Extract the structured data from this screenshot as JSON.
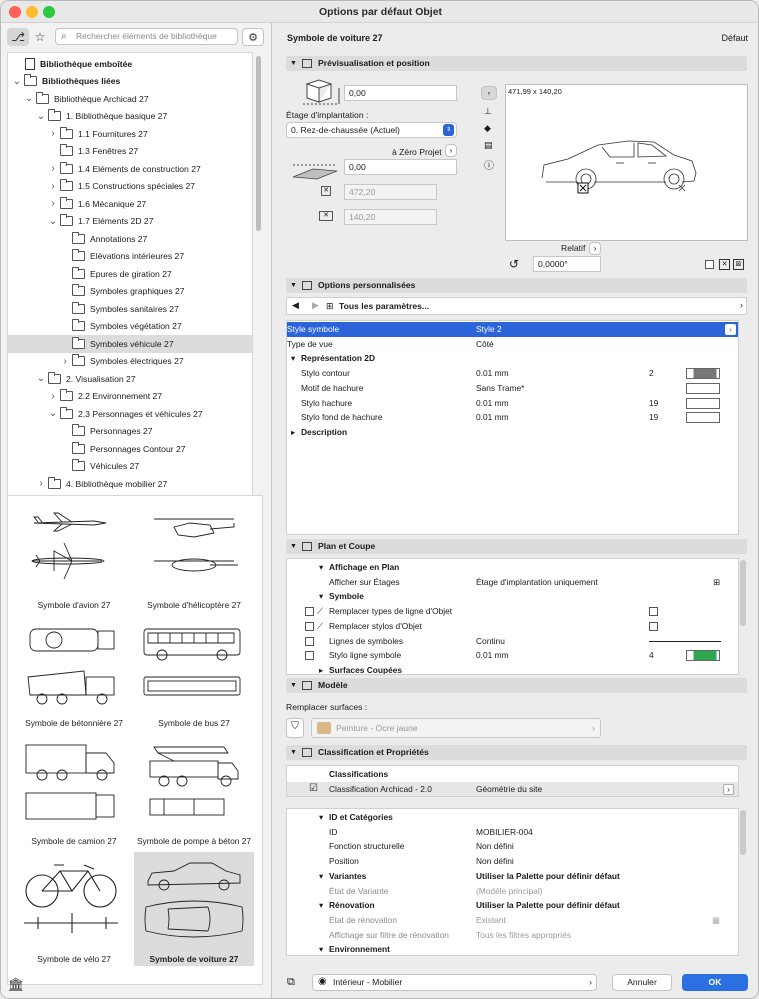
{
  "window": {
    "title": "Options par défaut Objet"
  },
  "library": {
    "search_placeholder": "Rechercher éléments de bibliothèque",
    "tree": [
      {
        "label": "Bibliothèque emboîtée",
        "level": 0,
        "arrow": "",
        "icon": "doc",
        "bold": true
      },
      {
        "label": "Bibliothèques liées",
        "level": 0,
        "arrow": "v",
        "icon": "stack",
        "bold": true
      },
      {
        "label": "Bibliothèque Archicad 27",
        "level": 1,
        "arrow": "v",
        "icon": "folder"
      },
      {
        "label": "1. Bibliothèque basique 27",
        "level": 2,
        "arrow": "v",
        "icon": "folder"
      },
      {
        "label": "1.1 Fournitures 27",
        "level": 3,
        "arrow": ">",
        "icon": "folder"
      },
      {
        "label": "1.3 Fenêtres 27",
        "level": 3,
        "arrow": "",
        "icon": "folder"
      },
      {
        "label": "1.4 Eléments de construction 27",
        "level": 3,
        "arrow": ">",
        "icon": "folder"
      },
      {
        "label": "1.5 Constructions spéciales 27",
        "level": 3,
        "arrow": ">",
        "icon": "folder"
      },
      {
        "label": "1.6 Mécanique 27",
        "level": 3,
        "arrow": ">",
        "icon": "folder"
      },
      {
        "label": "1.7 Eléments 2D 27",
        "level": 3,
        "arrow": "v",
        "icon": "folder"
      },
      {
        "label": "Annotations 27",
        "level": 4,
        "arrow": "",
        "icon": "folder"
      },
      {
        "label": "Elévations intérieures 27",
        "level": 4,
        "arrow": "",
        "icon": "folder"
      },
      {
        "label": "Epures de giration 27",
        "level": 4,
        "arrow": "",
        "icon": "folder"
      },
      {
        "label": "Symboles graphiques 27",
        "level": 4,
        "arrow": "",
        "icon": "folder"
      },
      {
        "label": "Symboles sanitaires 27",
        "level": 4,
        "arrow": "",
        "icon": "folder"
      },
      {
        "label": "Symboles végétation 27",
        "level": 4,
        "arrow": "",
        "icon": "folder"
      },
      {
        "label": "Symboles véhicule 27",
        "level": 4,
        "arrow": "",
        "icon": "folder",
        "selected": true
      },
      {
        "label": "Symboles électriques 27",
        "level": 4,
        "arrow": ">",
        "icon": "folder"
      },
      {
        "label": "2. Visualisation 27",
        "level": 2,
        "arrow": "v",
        "icon": "folder"
      },
      {
        "label": "2.2 Environnement 27",
        "level": 3,
        "arrow": ">",
        "icon": "folder"
      },
      {
        "label": "2.3 Personnages et véhicules 27",
        "level": 3,
        "arrow": "v",
        "icon": "folder"
      },
      {
        "label": "Personnages 27",
        "level": 4,
        "arrow": "",
        "icon": "folder"
      },
      {
        "label": "Personnages Contour 27",
        "level": 4,
        "arrow": "",
        "icon": "folder"
      },
      {
        "label": "Véhicules 27",
        "level": 4,
        "arrow": "",
        "icon": "folder"
      },
      {
        "label": "4. Bibliothèque mobilier 27",
        "level": 2,
        "arrow": ">",
        "icon": "folder"
      }
    ],
    "gallery": [
      {
        "label": "Symbole d'avion 27",
        "icon": "airplane-icon"
      },
      {
        "label": "Symbole d'hélicoptère 27",
        "icon": "helicopter-icon"
      },
      {
        "label": "Symbole de bétonnière 27",
        "icon": "concrete-mixer-icon"
      },
      {
        "label": "Symbole de bus 27",
        "icon": "bus-icon"
      },
      {
        "label": "Symbole de camion 27",
        "icon": "truck-icon"
      },
      {
        "label": "Symbole de pompe à béton 27",
        "icon": "concrete-pump-icon"
      },
      {
        "label": "Symbole de vélo 27",
        "icon": "bicycle-icon"
      },
      {
        "label": "Symbole de voiture 27",
        "icon": "car-icon",
        "selected": true
      }
    ]
  },
  "panel": {
    "object_name": "Symbole de voiture 27",
    "default_label": "Défaut",
    "preview_section": {
      "title": "Prévisualisation et position",
      "elevation_value": "0,00",
      "floor_label": "Étage d'implantation :",
      "floor_value": "0. Rez-de-chaussée (Actuel)",
      "zero_label": "à Zéro Projet",
      "zero_value": "0,00",
      "width_value": "472,20",
      "depth_value": "140,20",
      "preview_size": "471,99 x 140,20",
      "relative_label": "Relatif",
      "angle_value": "0,0000°"
    },
    "custom_section": {
      "title": "Options personnalisées",
      "nav_label": "Tous les paramètres...",
      "rows": [
        {
          "name": "Style symbole",
          "value": "Style 2",
          "selected": true,
          "indent": 0
        },
        {
          "name": "Type de vue",
          "value": "Côté",
          "indent": 0
        },
        {
          "name": "Représentation 2D",
          "value": "",
          "group": true,
          "arrow": "v"
        },
        {
          "name": "Stylo contour",
          "value": "0.01 mm",
          "num": "2",
          "swatch": "stripe-gray",
          "indent": 1
        },
        {
          "name": "Motif de hachure",
          "value": "Sans Trame*",
          "swatch": "empty",
          "indent": 1
        },
        {
          "name": "Stylo hachure",
          "value": "0.01 mm",
          "num": "19",
          "swatch": "empty",
          "indent": 1
        },
        {
          "name": "Stylo fond de hachure",
          "value": "0.01 mm",
          "num": "19",
          "swatch": "empty",
          "indent": 1
        },
        {
          "name": "Description",
          "value": "",
          "group": true,
          "arrow": ">"
        }
      ]
    },
    "plan_section": {
      "title": "Plan et Coupe",
      "rows": [
        {
          "name": "Affichage en Plan",
          "group": true,
          "arrow": "v"
        },
        {
          "name": "Afficher sur Étages",
          "value": "Étage d'implantation uniquement",
          "indent": 2
        },
        {
          "name": "Symbole",
          "group": true,
          "arrow": "v"
        },
        {
          "name": "Remplacer types de ligne d'Objet",
          "value": "",
          "check": true,
          "indent": 2
        },
        {
          "name": "Remplacer stylos d'Objet",
          "value": "",
          "check": true,
          "indent": 2
        },
        {
          "name": "Lignes de symboles",
          "value": "Continu",
          "line": true,
          "indent": 2
        },
        {
          "name": "Stylo ligne symbole",
          "value": "0.01 mm",
          "num": "4",
          "swatch": "stripe-green",
          "indent": 2
        },
        {
          "name": "Surfaces Coupées",
          "group": true,
          "arrow": ">"
        }
      ]
    },
    "model_section": {
      "title": "Modèle",
      "override_label": "Remplacer surfaces :",
      "surface_value": "Peinture - Ocre jaune",
      "surface_color": "#d9b98c"
    },
    "class_section": {
      "title": "Classification et Propriétés",
      "class_group": "Classifications",
      "class_name": "Classification Archicad - 2.0",
      "class_value": "Géométrie du site",
      "rows": [
        {
          "name": "ID et Catégories",
          "group": true,
          "arrow": "v"
        },
        {
          "name": "ID",
          "value": "MOBILIER-004",
          "indent": 2
        },
        {
          "name": "Fonction structurelle",
          "value": "Non défini",
          "indent": 2
        },
        {
          "name": "Position",
          "value": "Non défini",
          "indent": 2
        },
        {
          "name": "Variantes",
          "value": "Utiliser la Palette pour définir défaut",
          "group": true,
          "arrow": "v"
        },
        {
          "name": "État de Variante",
          "value": "(Modèle principal)",
          "indent": 2,
          "dim": true
        },
        {
          "name": "Rénovation",
          "value": "Utiliser la Palette pour définir défaut",
          "group": true,
          "arrow": "v"
        },
        {
          "name": "État de rénovation",
          "value": "Existant",
          "indent": 2,
          "dim": true
        },
        {
          "name": "Affichage sur filtre de rénovation",
          "value": "Tous les filtres appropriés",
          "indent": 2,
          "dim": true
        },
        {
          "name": "Environnement",
          "group": true,
          "arrow": "v"
        }
      ]
    },
    "footer": {
      "layer_value": "Intérieur - Mobilier",
      "cancel_label": "Annuler",
      "ok_label": "OK"
    }
  },
  "colors": {
    "accent": "#2b63d9",
    "ok": "#2b6fe0",
    "section": "#dcdcdc"
  }
}
